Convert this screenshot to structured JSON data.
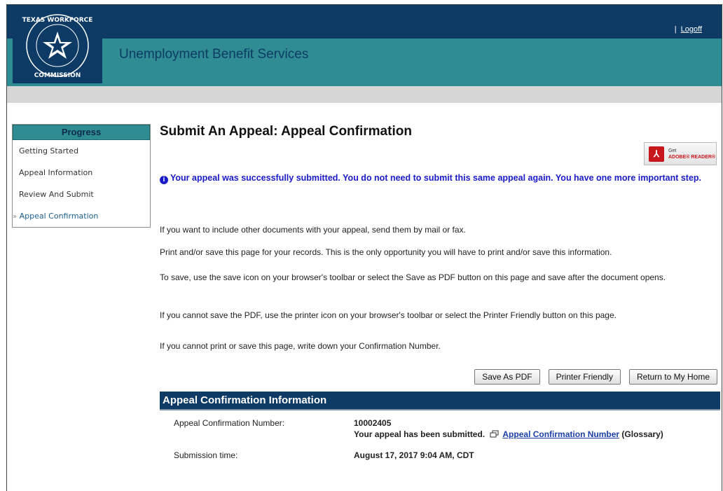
{
  "header": {
    "logo_text": "TEXAS WORKFORCE COMMISSION",
    "app_title": "Unemployment Benefit Services",
    "logoff": "Logoff",
    "colors": {
      "navy": "#0d3b66",
      "teal": "#2f8c92",
      "grey_bar": "#d6d6d6"
    }
  },
  "sidebar": {
    "heading": "Progress",
    "items": [
      {
        "label": "Getting Started"
      },
      {
        "label": "Appeal Information"
      },
      {
        "label": "Review And Submit"
      },
      {
        "label": "Appeal Confirmation",
        "active": true
      }
    ]
  },
  "main": {
    "title": "Submit An Appeal: Appeal Confirmation",
    "adobe_badge": {
      "line1": "Get",
      "line2": "ADOBE® READER®"
    },
    "alert": "Your appeal was successfully submitted.   You do not need to submit this same appeal again. You have one more important step.",
    "paragraphs": [
      "If you want to include other documents with your appeal, send them by mail or fax.",
      "Print and/or save this page for your records. This is the only opportunity you will have to print and/or save this information.",
      "To save, use the save icon on your browser's toolbar or select the Save as PDF button on this page and save after the document opens.",
      "If you cannot save the PDF, use the printer icon on your browser's toolbar or select the Printer Friendly button on this page.",
      "If you cannot print or save this page, write down your Confirmation Number."
    ],
    "buttons": {
      "save_pdf": "Save As PDF",
      "printer_friendly": "Printer Friendly",
      "return_home": "Return to My Home"
    },
    "section": {
      "title": "Appeal Confirmation Information",
      "confirmation_label": "Appeal Confirmation Number:",
      "confirmation_number": "10002405",
      "submitted_text": "Your appeal has been submitted.",
      "glossary_link": "Appeal Confirmation Number",
      "glossary_suffix": "(Glossary)",
      "submission_label": "Submission time:",
      "submission_value": "August 17, 2017 9:04 AM, CDT"
    }
  }
}
